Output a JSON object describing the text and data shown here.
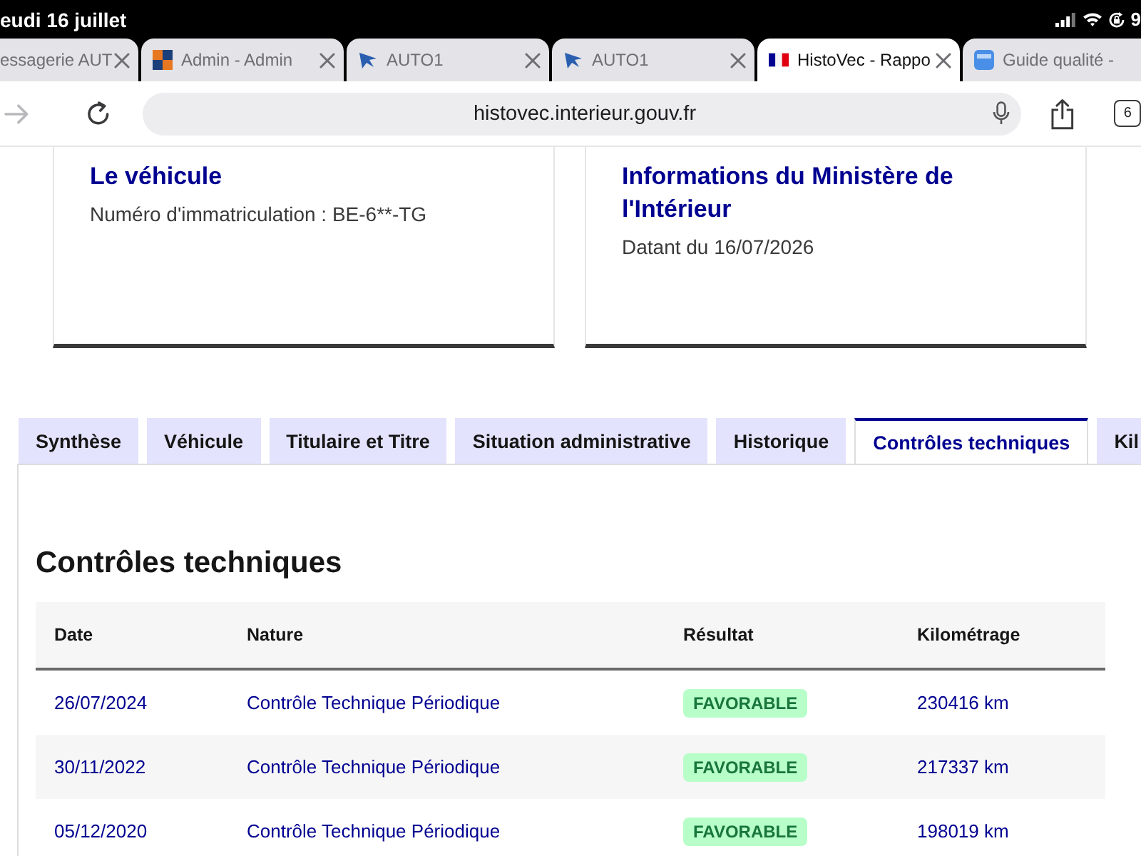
{
  "status_bar": {
    "date": "eudi 16 juillet",
    "battery": "9"
  },
  "browser_tabs": [
    {
      "title": "essagerie AUT",
      "kind": "plain",
      "selected": false
    },
    {
      "title": "Admin - Admin",
      "kind": "grid",
      "selected": false
    },
    {
      "title": "AUTO1",
      "kind": "logo",
      "selected": false
    },
    {
      "title": "AUTO1",
      "kind": "logo",
      "selected": false
    },
    {
      "title": "HistoVec - Rappo",
      "kind": "flag",
      "selected": true
    },
    {
      "title": "Guide qualité -",
      "kind": "tile",
      "selected": false
    }
  ],
  "toolbar": {
    "url": "histovec.interieur.gouv.fr",
    "tab_count": "6"
  },
  "cards": [
    {
      "title": "Le véhicule",
      "text": "Numéro d'immatriculation : BE-6**-TG"
    },
    {
      "title": "Informations du Ministère de l'Intérieur",
      "text": "Datant du 16/07/2026"
    }
  ],
  "tabs": [
    {
      "label": "Synthèse",
      "selected": false
    },
    {
      "label": "Véhicule",
      "selected": false
    },
    {
      "label": "Titulaire et Titre",
      "selected": false
    },
    {
      "label": "Situation administrative",
      "selected": false
    },
    {
      "label": "Historique",
      "selected": false
    },
    {
      "label": "Contrôles techniques",
      "selected": true
    },
    {
      "label": "Kil",
      "selected": false
    }
  ],
  "panel": {
    "title": "Contrôles techniques",
    "table": {
      "columns": [
        "Date",
        "Nature",
        "Résultat",
        "Kilométrage"
      ],
      "rows": [
        {
          "date": "26/07/2024",
          "nature": "Contrôle Technique Périodique",
          "result": "FAVORABLE",
          "mileage": "230416 km"
        },
        {
          "date": "30/11/2022",
          "nature": "Contrôle Technique Périodique",
          "result": "FAVORABLE",
          "mileage": "217337 km"
        },
        {
          "date": "05/12/2020",
          "nature": "Contrôle Technique Périodique",
          "result": "FAVORABLE",
          "mileage": "198019 km"
        }
      ]
    }
  }
}
